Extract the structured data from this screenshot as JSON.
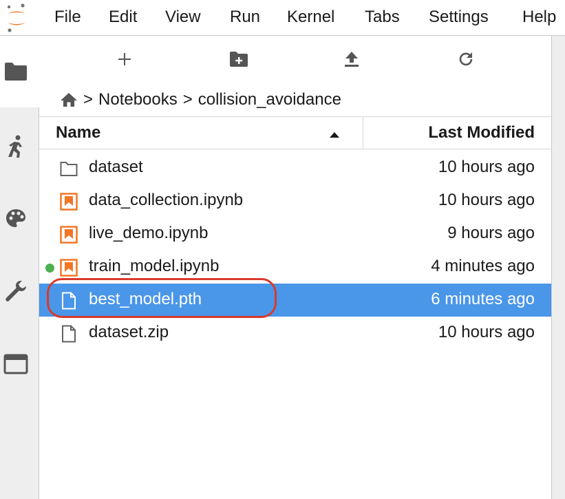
{
  "menu": {
    "items": [
      "File",
      "Edit",
      "View",
      "Run",
      "Kernel",
      "Tabs",
      "Settings",
      "Help"
    ]
  },
  "sidebar": {
    "icons": [
      "folder-icon",
      "running-icon",
      "palette-icon",
      "wrench-icon",
      "tabs-icon"
    ]
  },
  "toolbar": {
    "buttons": [
      "new-launcher-icon",
      "new-folder-icon",
      "upload-icon",
      "refresh-icon"
    ]
  },
  "breadcrumb": {
    "home_icon": "home-icon",
    "separator": ">",
    "parts": [
      "Notebooks",
      "collision_avoidance"
    ]
  },
  "file_list": {
    "columns": {
      "name": "Name",
      "modified": "Last Modified"
    },
    "sort": {
      "column": "Name",
      "direction": "ascending"
    },
    "files": [
      {
        "name": "dataset",
        "modified": "10 hours ago",
        "type": "folder",
        "running": false,
        "selected": false
      },
      {
        "name": "data_collection.ipynb",
        "modified": "10 hours ago",
        "type": "notebook",
        "running": false,
        "selected": false
      },
      {
        "name": "live_demo.ipynb",
        "modified": "9 hours ago",
        "type": "notebook",
        "running": false,
        "selected": false
      },
      {
        "name": "train_model.ipynb",
        "modified": "4 minutes ago",
        "type": "notebook",
        "running": true,
        "selected": false
      },
      {
        "name": "best_model.pth",
        "modified": "6 minutes ago",
        "type": "file",
        "running": false,
        "selected": true
      },
      {
        "name": "dataset.zip",
        "modified": "10 hours ago",
        "type": "file",
        "running": false,
        "selected": false
      }
    ]
  },
  "colors": {
    "accent_orange": "#f37626",
    "selection_blue": "#4a96e8",
    "running_green": "#4caf50",
    "highlight_red": "#d93a2b"
  }
}
